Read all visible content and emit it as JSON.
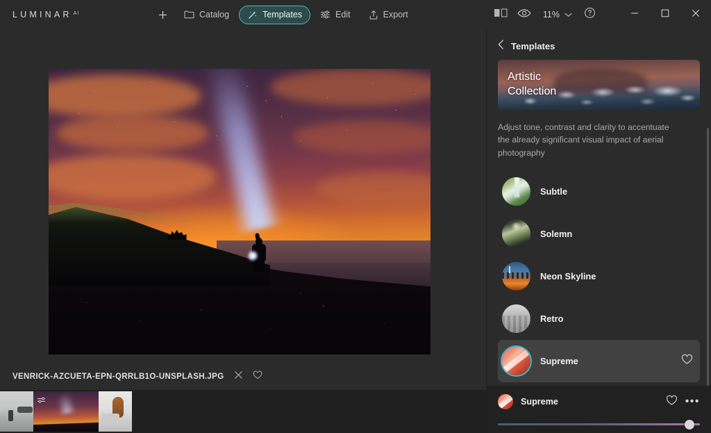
{
  "app": {
    "brand": "LUMINAR",
    "brand_suffix": "AI"
  },
  "toolbar": {
    "add_label": "",
    "items": [
      {
        "label": "Catalog",
        "icon": "folder-icon",
        "active": false
      },
      {
        "label": "Templates",
        "icon": "magic-wand-icon",
        "active": true
      },
      {
        "label": "Edit",
        "icon": "sliders-icon",
        "active": false
      },
      {
        "label": "Export",
        "icon": "export-icon",
        "active": false
      }
    ],
    "compare_icon": "compare-view-icon",
    "preview_icon": "eye-icon",
    "zoom_level": "11%",
    "help_icon": "help-circle-icon",
    "window": {
      "minimize": "minimize-icon",
      "maximize": "maximize-icon",
      "close": "close-icon"
    }
  },
  "canvas": {
    "image_alt": "Person with flashlight on rocky shore at sunset under starry sky"
  },
  "filebar": {
    "filename": "VENRICK-AZCUETA-EPN-QRRLB1O-UNSPLASH.JPG",
    "close_icon": "close-icon",
    "favorite_icon": "heart-icon"
  },
  "filmstrip": {
    "items": [
      {
        "name": "thumbnail-beach",
        "selected": false
      },
      {
        "name": "thumbnail-night-flashlight",
        "selected": true
      },
      {
        "name": "thumbnail-interior",
        "selected": false
      }
    ]
  },
  "panel": {
    "back_icon": "chevron-left-icon",
    "title": "Templates",
    "hero": {
      "line1": "Artistic",
      "line2": "Collection"
    },
    "description": "Adjust tone, contrast and clarity to accentuate the already significant visual impact of aerial photography",
    "templates": [
      {
        "label": "Subtle",
        "thumb": "t-subtle",
        "selected": false
      },
      {
        "label": "Solemn",
        "thumb": "t-solemn",
        "selected": false
      },
      {
        "label": "Neon Skyline",
        "thumb": "t-neon",
        "selected": false
      },
      {
        "label": "Retro",
        "thumb": "t-retro",
        "selected": false
      },
      {
        "label": "Supreme",
        "thumb": "t-supreme",
        "selected": true
      }
    ],
    "footer": {
      "name": "Supreme",
      "favorite_icon": "heart-icon",
      "more_icon": "more-dots-icon",
      "more_glyph": "•••",
      "slider_value": 97
    }
  },
  "colors": {
    "accent_teal": "#4fb8b8",
    "selection_blue": "#3fa9d8",
    "panel_bg": "#2b2b2b",
    "footer_bg": "#212121",
    "selected_row": "#414141"
  }
}
